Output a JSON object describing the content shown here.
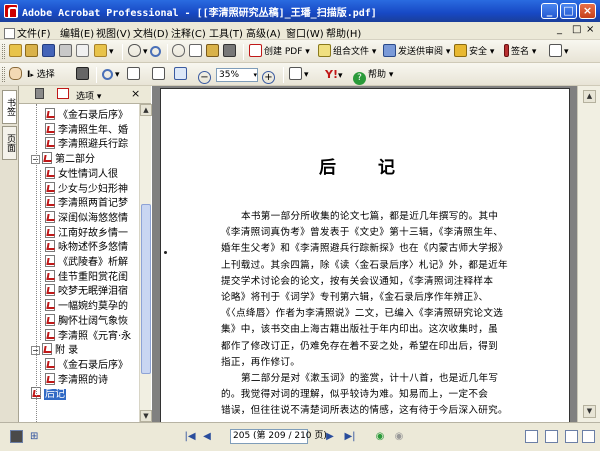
{
  "window": {
    "title": "Adobe Acrobat Professional - [[李清照研究丛稿]_王璠_扫描版.pdf]",
    "controls": [
      "_",
      "□",
      "×"
    ]
  },
  "menubar": {
    "items": [
      "文件(F)",
      "编辑(E)",
      "视图(V)",
      "文档(D)",
      "注释(C)",
      "工具(T)",
      "高级(A)",
      "窗口(W)",
      "帮助(H)"
    ],
    "mdi_controls": [
      "_",
      "□",
      "×"
    ]
  },
  "toolbar1": {
    "create_pdf": "创建 PDF",
    "combine": "组合文件",
    "send_review": "发送供审阅",
    "secure": "安全",
    "sign": "签名"
  },
  "toolbar2": {
    "select": "选择",
    "zoom_value": "35%",
    "help": "帮助"
  },
  "left_tabs": [
    "书签",
    "页面"
  ],
  "bookmarks": {
    "options_label": "选项",
    "items": [
      {
        "label": "《金石录后序》",
        "level": 2
      },
      {
        "label": "李清照生年、婚",
        "level": 2
      },
      {
        "label": "李清照避兵行踪",
        "level": 2
      },
      {
        "label": "第二部分",
        "level": 1,
        "expanded": true
      },
      {
        "label": "女性情词人很",
        "level": 2
      },
      {
        "label": "少女与少妇形神",
        "level": 2
      },
      {
        "label": "李清照两首记梦",
        "level": 2
      },
      {
        "label": "深闺似海悠悠情",
        "level": 2
      },
      {
        "label": "江南好故乡情一",
        "level": 2
      },
      {
        "label": "咏物述怀多悠情",
        "level": 2
      },
      {
        "label": "《武陵春》析解",
        "level": 2
      },
      {
        "label": "佳节重阳赏花闺",
        "level": 2
      },
      {
        "label": "咬梦无眠弹泪宿",
        "level": 2
      },
      {
        "label": "一幅婉约莫孕的",
        "level": 2
      },
      {
        "label": "胸怀壮阔气象恢",
        "level": 2
      },
      {
        "label": "李清照《元宵·永",
        "level": 2
      },
      {
        "label": "附  录",
        "level": 1,
        "expanded": true
      },
      {
        "label": "《金石录后序》",
        "level": 2
      },
      {
        "label": "李清照的诗",
        "level": 2
      },
      {
        "label": "后记",
        "level": 1,
        "selected": true
      }
    ]
  },
  "document": {
    "heading": "后  记",
    "lines": [
      {
        "text": "本书第一部分所收集的论文七篇，都是近几年撰写的。其中",
        "indent": true
      },
      {
        "text": "《李清照词真伪考》曾发表于《文史》第十三辑，《李清照生年、",
        "indent": false
      },
      {
        "text": "婚年生父考》和《李清照避兵行踪新探》也在《内蒙古师大学报》",
        "indent": false
      },
      {
        "text": "上刊载过。其余四篇，除《读〈金石录后序〉札记》外，都是近年",
        "indent": false
      },
      {
        "text": "提交学术讨论会的论文，按有关会议通知，《李清照词注释样本",
        "indent": false
      },
      {
        "text": "论略》将刊于《词学》专刊第六辑，《金石录后序作年辨正》、",
        "indent": false
      },
      {
        "text": "《〈点绛唇〉作者为李清照说》二文，已编入《李清照研究论文选",
        "indent": false
      },
      {
        "text": "集》中，该书交由上海古籍出版社于年内印出。这次收集时，虽",
        "indent": false
      },
      {
        "text": "都作了修改订正，仍难免存在着不妥之处，希望在印出后，得到",
        "indent": false
      },
      {
        "text": "指正，再作修订。",
        "indent": false
      },
      {
        "text": "第二部分是对《漱玉词》的鉴赏，计十八首，也是近几年写",
        "indent": true
      },
      {
        "text": "的。我觉得对词的理解，似乎较诗为难。知易而上，一定不会",
        "indent": false
      },
      {
        "text": "错误，但往往说不清楚词所表达的情感，这有待于今后深入研究。",
        "indent": false
      }
    ]
  },
  "statusbar": {
    "page_field": "205 (第 209 / 210 页)"
  }
}
